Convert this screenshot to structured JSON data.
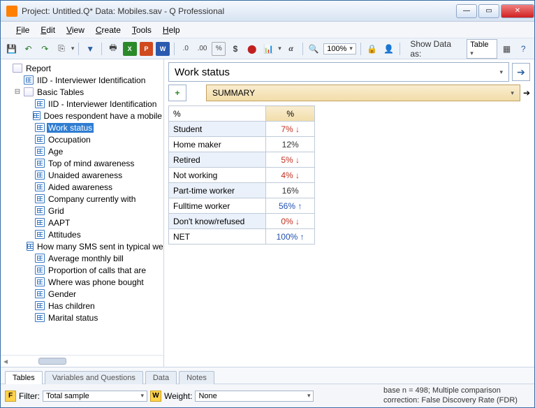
{
  "window": {
    "title": "Project: Untitled.Q*  Data: Mobiles.sav - Q Professional"
  },
  "menu": {
    "file": "File",
    "edit": "Edit",
    "view": "View",
    "create": "Create",
    "tools": "Tools",
    "help": "Help"
  },
  "toolbar": {
    "zoom": "100%",
    "show_label": "Show Data as:",
    "show_value": "Table"
  },
  "tree": {
    "root": "Report",
    "items": [
      {
        "label": "IID - Interviewer Identification",
        "level": 1
      },
      {
        "label": "Basic Tables",
        "level": 1,
        "expanded": true,
        "folder": true
      }
    ],
    "basic": [
      "IID - Interviewer Identification",
      "Does respondent have a mobile",
      "Work status",
      "Occupation",
      "Age",
      "Top of mind awareness",
      "Unaided awareness",
      "Aided awareness",
      "Company currently with",
      "Grid",
      "AAPT",
      "Attitudes",
      "How many SMS sent in typical week",
      "Average monthly bill",
      "Proportion of calls that are",
      "Where was phone bought",
      "Gender",
      "Has children",
      "Marital status"
    ],
    "selected": "Work status"
  },
  "content": {
    "variable": "Work status",
    "summary": "SUMMARY",
    "col_label": "%",
    "col_value": "%"
  },
  "chart_data": {
    "type": "table",
    "rows": [
      {
        "label": "Student",
        "value": "7%",
        "dir": "down"
      },
      {
        "label": "Home maker",
        "value": "12%",
        "dir": "none"
      },
      {
        "label": "Retired",
        "value": "5%",
        "dir": "down"
      },
      {
        "label": "Not working",
        "value": "4%",
        "dir": "down"
      },
      {
        "label": "Part-time worker",
        "value": "16%",
        "dir": "none"
      },
      {
        "label": "Fulltime worker",
        "value": "56%",
        "dir": "up"
      },
      {
        "label": "Don't know/refused",
        "value": "0%",
        "dir": "down"
      },
      {
        "label": "NET",
        "value": "100%",
        "dir": "up"
      }
    ]
  },
  "tabs": {
    "t1": "Tables",
    "t2": "Variables and Questions",
    "t3": "Data",
    "t4": "Notes"
  },
  "status": {
    "filter_label": "Filter:",
    "filter_value": "Total sample",
    "weight_label": "Weight:",
    "weight_value": "None",
    "info": "base n = 498; Multiple comparison correction: False Discovery Rate (FDR)"
  }
}
